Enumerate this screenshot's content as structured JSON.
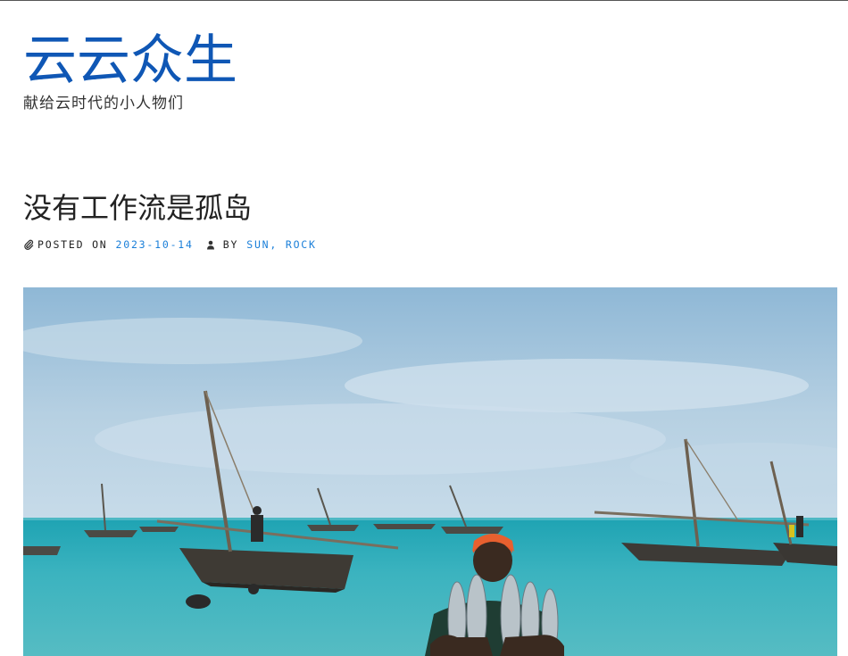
{
  "site": {
    "title": "云云众生",
    "tagline": "献给云时代的小人物们"
  },
  "post": {
    "title": "没有工作流是孤岛",
    "posted_label": "POSTED ON",
    "date": "2023-10-14",
    "by_label": "BY",
    "authors": [
      "SUN",
      "ROCK"
    ],
    "author_separator": ", ",
    "featured_image": {
      "icon": "hero-photo"
    }
  },
  "icons": {
    "posted": "paperclip-icon",
    "author": "user-icon"
  },
  "colors": {
    "title": "#0f57b5",
    "link": "#1a7fd9",
    "text": "#222222"
  }
}
